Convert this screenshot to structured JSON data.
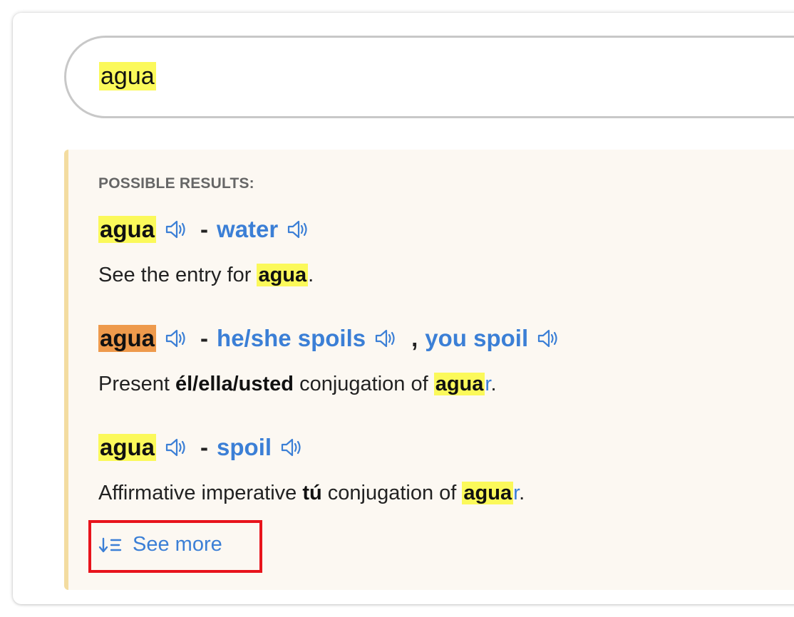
{
  "search": {
    "value": "agua"
  },
  "results": {
    "heading": "POSSIBLE RESULTS:",
    "entries": [
      {
        "word": "agua",
        "highlight": "yellow",
        "translations": [
          "water"
        ],
        "description_parts": [
          "See the entry for ",
          "agua",
          "."
        ]
      },
      {
        "word": "agua",
        "highlight": "orange",
        "translations": [
          "he/she spoils",
          "you spoil"
        ],
        "separator": ",",
        "description_parts": [
          "Present ",
          "él/ella/usted",
          " conjugation of ",
          "agua",
          "r",
          "."
        ]
      },
      {
        "word": "agua",
        "highlight": "yellow",
        "translations": [
          "spoil"
        ],
        "description_parts": [
          "Affirmative imperative ",
          "tú",
          " conjugation of ",
          "agua",
          "r",
          "."
        ]
      }
    ],
    "dash": "-",
    "see_more": "See more"
  },
  "colors": {
    "highlight_yellow": "#fbf95a",
    "highlight_orange": "#ee9a4c",
    "link_blue": "#3b7fd6",
    "panel_bg": "#fcf8f2",
    "panel_border": "#f3dca0",
    "focus_outline": "#e8141c"
  },
  "icons": {
    "audio": "speaker-icon",
    "see_more": "sort-down-list-icon"
  }
}
